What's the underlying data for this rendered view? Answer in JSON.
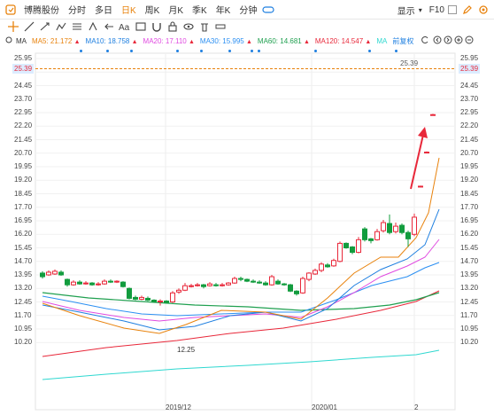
{
  "toolbar": {
    "stock_name": "博腾股份",
    "periods": [
      "分时",
      "多日",
      "日K",
      "周K",
      "月K",
      "季K",
      "年K",
      "分钟"
    ],
    "active_period": "日K",
    "display_label": "显示",
    "f10_label": "F10"
  },
  "ma_bar": {
    "items": [
      {
        "label": "MA5: 21.172",
        "color": "#e8820c"
      },
      {
        "label": "MA10: 18.758",
        "color": "#1e7fe0"
      },
      {
        "label": "MA20: 17.110",
        "color": "#e04ae0"
      },
      {
        "label": "MA30: 15.995",
        "color": "#2b8ff2"
      },
      {
        "label": "MA60: 14.681",
        "color": "#20a050"
      },
      {
        "label": "MA120: 14.547",
        "color": "#e8283a"
      }
    ],
    "ma_truncated": "MA",
    "restore_label": "前复权"
  },
  "ma_label": "MA",
  "price_axis": [
    "25.95",
    "25.39",
    "24.45",
    "23.70",
    "22.95",
    "22.20",
    "21.45",
    "20.70",
    "19.95",
    "19.20",
    "18.45",
    "17.70",
    "16.95",
    "16.20",
    "15.45",
    "14.70",
    "13.95",
    "13.20",
    "12.45",
    "11.70",
    "10.95",
    "10.20"
  ],
  "current_price": "25.39",
  "low_annotation": "12.25",
  "date_labels": [
    "2019/12",
    "2020/01",
    "2"
  ],
  "colors": {
    "up": "#e8283a",
    "down": "#129c3e",
    "ma5": "#e8820c",
    "ma10": "#1e7fe0",
    "ma20": "#e04ae0",
    "ma30": "#2b8ff2",
    "ma60": "#20a050",
    "ma120": "#e8283a",
    "ma250": "#2fd8d0"
  }
}
